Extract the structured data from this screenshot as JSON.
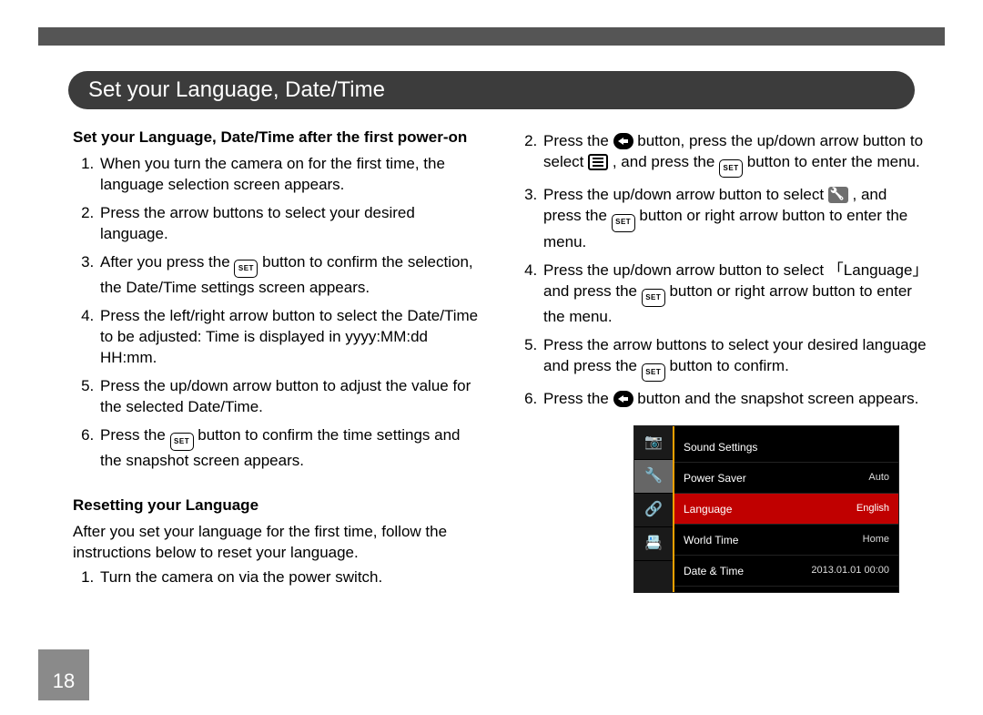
{
  "page_number": "18",
  "title": "Set your Language, Date/Time",
  "section1": {
    "heading": "Set your Language, Date/Time after the first power-on",
    "steps": [
      "When you turn the camera on for the first time, the language selection screen appears.",
      "Press the arrow buttons to select your desired language.",
      {
        "pre": "After you press the ",
        "mid_icon": "set",
        "post": " button to confirm the selection, the Date/Time settings screen appears."
      },
      "Press the left/right arrow button to select the Date/Time to be adjusted: Time is displayed in yyyy:MM:dd HH:mm.",
      "Press the up/down arrow button to adjust the value for the selected Date/Time.",
      {
        "pre": "Press the ",
        "mid_icon": "set",
        "post": " button to confirm the time settings and the snapshot screen appears."
      }
    ]
  },
  "section2": {
    "heading": "Resetting your Language",
    "intro": "After you set your language for the first time, follow the instructions below to reset your language.",
    "steps_left": [
      "Turn the camera on via the power switch."
    ],
    "steps_right": [
      {
        "num": "2.",
        "pre": "Press the ",
        "ic1": "back",
        "mid1": " button, press the up/down arrow button to select ",
        "ic2": "menu",
        "mid2": " , and press the ",
        "ic3": "set",
        "post": " button to enter the menu."
      },
      {
        "num": "3.",
        "pre": "Press the up/down arrow button to select ",
        "ic1": "wrench",
        "mid1": " , and press the ",
        "ic2": "set",
        "post": " button or right arrow button to enter the menu."
      },
      {
        "num": "4.",
        "pre": " Press the up/down arrow button to select 「Language」and press the ",
        "ic1": "set",
        "post": " button or right arrow button to enter the menu."
      },
      {
        "num": "5.",
        "pre": "Press the arrow buttons to select your desired language and press the ",
        "ic1": "set",
        "post": " button to confirm."
      },
      {
        "num": "6.",
        "pre": "Press the ",
        "ic1": "back",
        "post": " button and the snapshot screen appears."
      }
    ]
  },
  "camera_menu": {
    "tabs": [
      "📷",
      "🔧",
      "🔗",
      "📇"
    ],
    "selected_tab_index": 1,
    "rows": [
      {
        "label": "Sound Settings",
        "value": ""
      },
      {
        "label": "Power Saver",
        "value": "Auto"
      },
      {
        "label": "Language",
        "value": "English",
        "selected": true
      },
      {
        "label": "World Time",
        "value": "Home"
      },
      {
        "label": "Date & Time",
        "value": "2013.01.01 00:00"
      }
    ]
  },
  "icon_text": {
    "set": "SET"
  }
}
